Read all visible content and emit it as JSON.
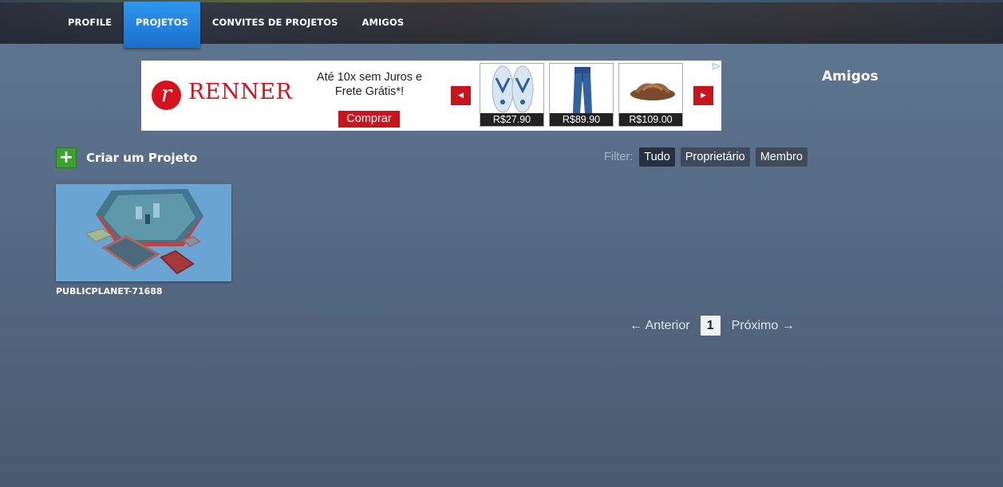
{
  "nav": {
    "items": [
      {
        "label": "PROFILE"
      },
      {
        "label": "PROJETOS"
      },
      {
        "label": "CONVITES DE PROJETOS"
      },
      {
        "label": "AMIGOS"
      }
    ],
    "active": "PROJETOS"
  },
  "ad": {
    "logo_mark": "r",
    "logo_text": "RENNER",
    "headline": "Até 10x sem Juros e Frete Grátis*!",
    "buy_label": "Comprar",
    "products": [
      {
        "name": "flip-flops",
        "price": "R$27.90"
      },
      {
        "name": "jeans",
        "price": "R$89.90"
      },
      {
        "name": "sandals",
        "price": "R$109.00"
      }
    ],
    "prev_icon": "arrow-left-icon",
    "next_icon": "arrow-right-icon",
    "choices_icon": "adchoices-icon",
    "brand_color": "#d5121d"
  },
  "sidebar": {
    "title": "Amigos"
  },
  "actions": {
    "create_label": "Criar um Projeto",
    "create_icon": "plus-icon"
  },
  "filter": {
    "label": "Filter:",
    "options": [
      "Tudo",
      "Proprietário",
      "Membro"
    ],
    "selected": "Tudo"
  },
  "projects": [
    {
      "name": "PUBLICPLANET-71688"
    }
  ],
  "pagination": {
    "prev_label": "← Anterior",
    "current_page": "1",
    "next_label": "Próximo →"
  }
}
